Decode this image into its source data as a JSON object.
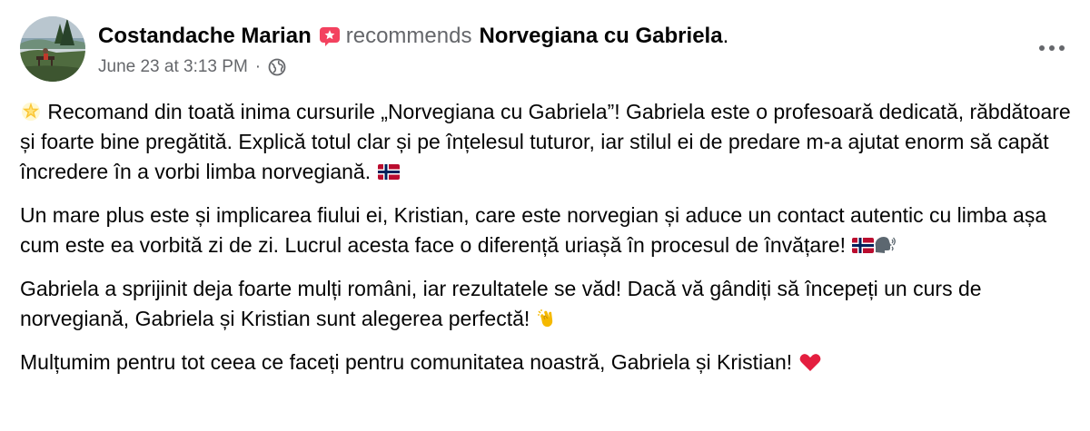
{
  "post": {
    "author_name": "Costandache Marian",
    "recommends_text": "recommends",
    "page_name": "Norvegiana cu Gabriela",
    "period": ".",
    "timestamp": "June 23 at 3:13 PM",
    "separator": "·",
    "audience_icon": "globe-icon",
    "more_icon": "more-options-icon",
    "recommend_icon": "recommend-star-icon"
  },
  "body": {
    "p1_text": "Recomand din toată inima cursurile „Norvegiana cu Gabriela”! Gabriela este o profesoară dedicată, răbdătoare și foarte bine pregătită. Explică totul clar și pe înțelesul tuturor, iar stilul ei de predare m-a ajutat enorm să capăt încredere în a vorbi limba norvegiană.",
    "p2_text": "Un mare plus este și implicarea fiului ei, Kristian, care este norvegian și aduce un contact autentic cu limba așa cum este ea vorbită zi de zi. Lucrul acesta face o diferență uriașă în procesul de învățare!",
    "p3_text": "Gabriela a sprijinit deja foarte mulți români, iar rezultatele se văd! Dacă vă gândiți să începeți un curs de norvegiană, Gabriela și Kristian sunt alegerea perfectă!",
    "p4_text": "Mulțumim pentru tot ceea ce faceți pentru comunitatea noastră, Gabriela și  Kristian!"
  },
  "colors": {
    "primary_text": "#050505",
    "secondary_text": "#65676b",
    "recommend_badge": "#f3425f",
    "norway_red": "#ba0c2f",
    "norway_blue": "#00205b",
    "heart_red": "#e41e3f"
  },
  "emoji": [
    "glowing-star-icon",
    "norway-flag-icon",
    "speaking-head-icon",
    "clapping-hands-icon",
    "red-heart-icon"
  ]
}
